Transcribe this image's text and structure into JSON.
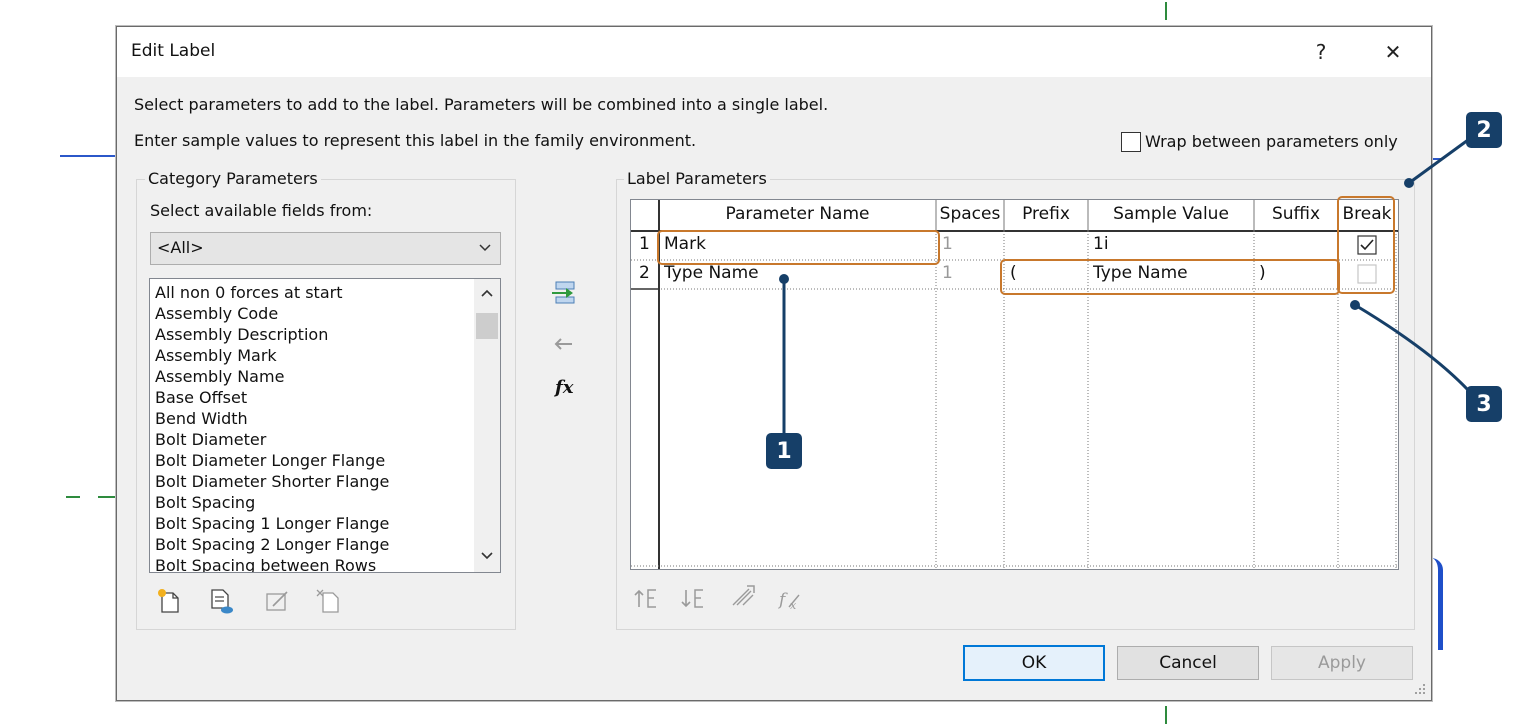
{
  "dialog": {
    "title": "Edit Label",
    "help_label": "?",
    "close_label": "✕",
    "instruction_1": "Select parameters to add to the label.  Parameters will be combined into a single label.",
    "instruction_2": "Enter sample values to represent this label in the family environment.",
    "wrap_label": "Wrap between parameters only",
    "wrap_checked": false
  },
  "category": {
    "group_label": "Category Parameters",
    "select_label": "Select available fields from:",
    "selected_value": "<All>",
    "items": [
      "All non 0 forces at start",
      "Assembly Code",
      "Assembly Description",
      "Assembly Mark",
      "Assembly Name",
      "Base Offset",
      "Bend Width",
      "Bolt Diameter",
      "Bolt Diameter Longer Flange",
      "Bolt Diameter Shorter Flange",
      "Bolt Spacing",
      "Bolt Spacing 1 Longer Flange",
      "Bolt Spacing 2 Longer Flange",
      "Bolt Spacing between Rows"
    ]
  },
  "label_params": {
    "group_label": "Label Parameters",
    "columns": [
      "Parameter Name",
      "Spaces",
      "Prefix",
      "Sample Value",
      "Suffix",
      "Break"
    ],
    "rows": [
      {
        "num": "1",
        "name": "Mark",
        "spaces": "1",
        "prefix": "",
        "sample": "1i",
        "suffix": "",
        "break": true
      },
      {
        "num": "2",
        "name": "Type Name",
        "spaces": "1",
        "prefix": "(",
        "sample": "Type Name",
        "suffix": ")",
        "break": false
      }
    ]
  },
  "buttons": {
    "ok": "OK",
    "cancel": "Cancel",
    "apply": "Apply"
  },
  "fx_label": "fx",
  "markers": [
    "1",
    "2",
    "3"
  ],
  "colors": {
    "callout": "#c8782c",
    "marker": "#163f68",
    "accent": "#0078d7"
  }
}
